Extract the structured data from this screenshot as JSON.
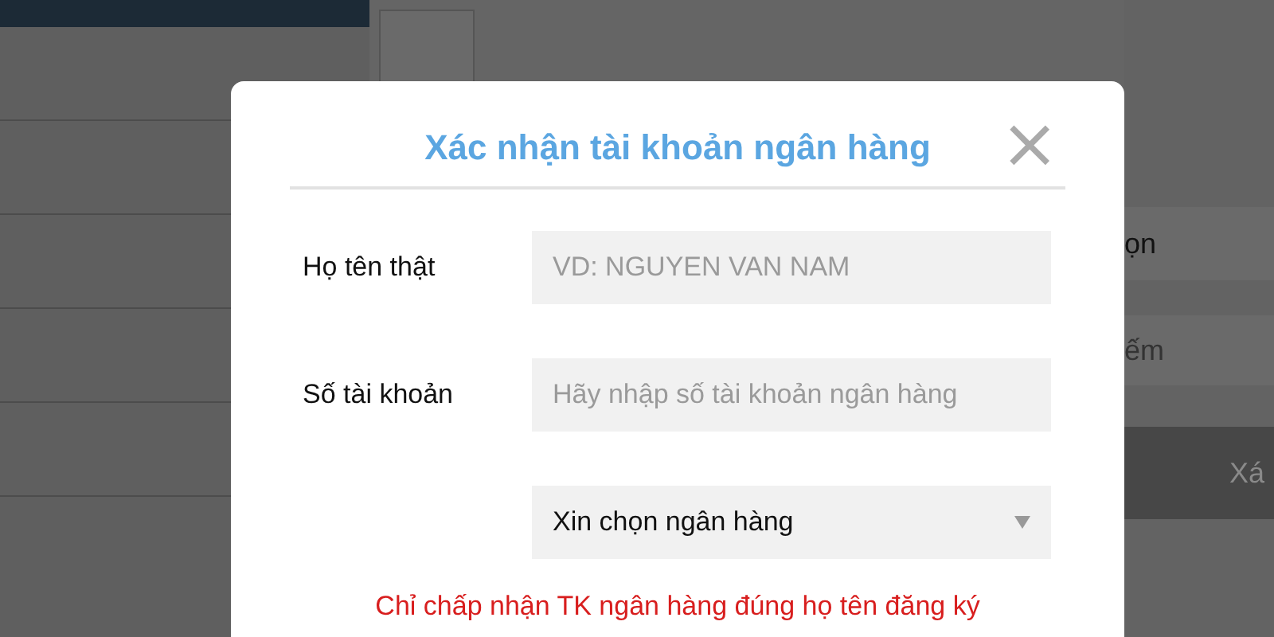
{
  "background": {
    "fragments": [
      "ọn",
      "ếm",
      "Xá"
    ]
  },
  "dialog": {
    "title": "Xác nhận tài khoản ngân hàng",
    "close": "×",
    "fields": [
      {
        "kind": "input",
        "label": "Họ tên thật",
        "placeholder": "VD: NGUYEN VAN NAM"
      },
      {
        "kind": "input",
        "label": "Số tài khoản",
        "placeholder": "Hãy nhập số tài khoản ngân hàng"
      },
      {
        "kind": "select",
        "value": "Xin chọn ngân hàng"
      }
    ],
    "notice": "Chỉ chấp nhận TK ngân hàng đúng họ tên đăng ký"
  }
}
